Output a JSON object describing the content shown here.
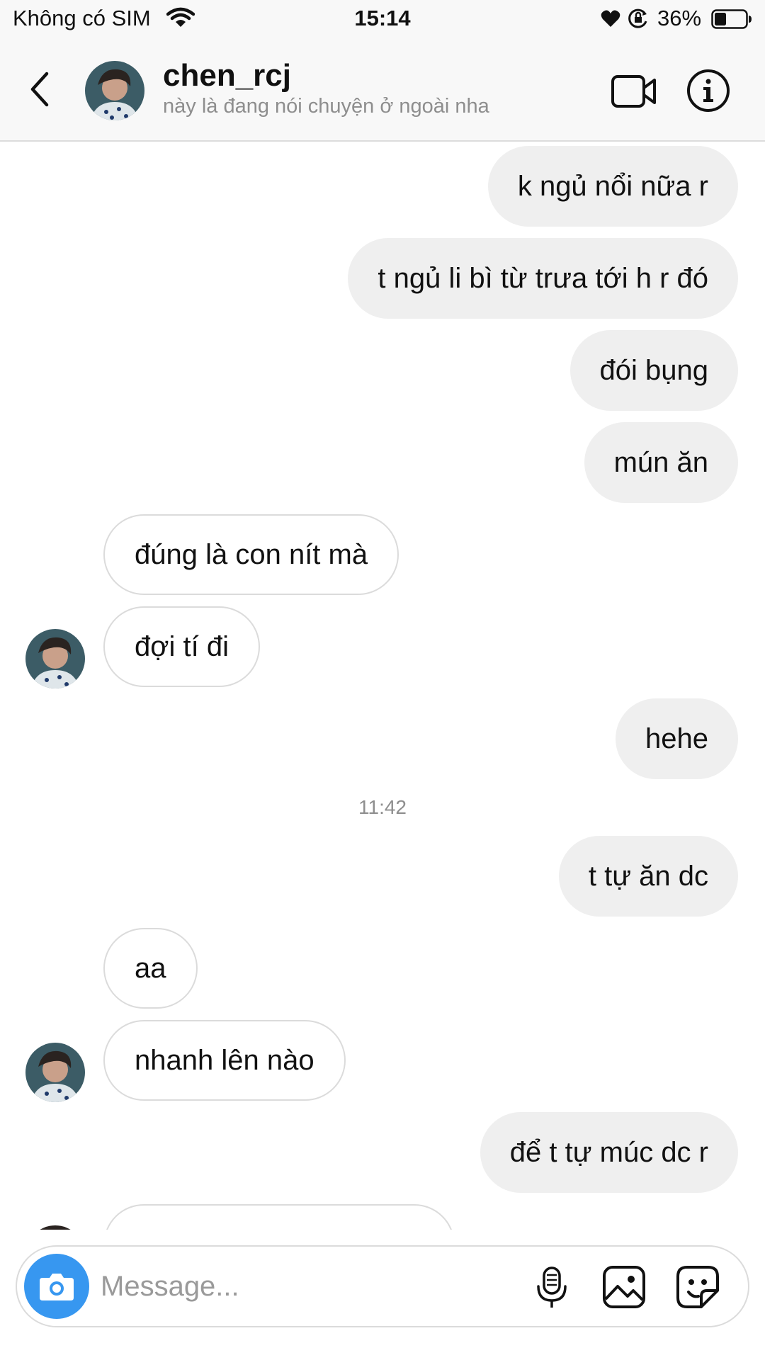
{
  "status_bar": {
    "carrier": "Không có SIM",
    "time": "15:14",
    "battery": "36%",
    "icons": [
      "wifi-icon",
      "heart-icon",
      "rotation-lock-icon",
      "battery-icon"
    ]
  },
  "header": {
    "username": "chen_rcj",
    "status": "này là đang nói chuyện ở ngoài nha",
    "icons": [
      "back-icon",
      "video-call-icon",
      "info-icon"
    ]
  },
  "messages": [
    {
      "from": "me",
      "text": "k ngủ nổi nữa r"
    },
    {
      "from": "me",
      "text": "t ngủ li bì từ trưa tới h r đó"
    },
    {
      "from": "me",
      "text": "đói bụng"
    },
    {
      "from": "me",
      "text": "mún ăn"
    },
    {
      "from": "them",
      "text": "đúng là con nít mà"
    },
    {
      "from": "them",
      "text": "đợi tí đi"
    },
    {
      "from": "me",
      "text": "hehe"
    },
    {
      "from": "me",
      "text": "t tự ăn dc"
    },
    {
      "from": "them",
      "text": "aa"
    },
    {
      "from": "them",
      "text": "nhanh lên nào"
    },
    {
      "from": "me",
      "text": "để t tự múc dc r"
    }
  ],
  "timestamp": "11:42",
  "composer": {
    "placeholder": "Message...",
    "icons": [
      "camera-icon",
      "microphone-icon",
      "gallery-icon",
      "sticker-icon"
    ]
  },
  "colors": {
    "outgoing_bubble": "#efefef",
    "incoming_border": "#dbdbdb",
    "camera_button": "#3797f0",
    "secondary_text": "#8e8e8e"
  }
}
